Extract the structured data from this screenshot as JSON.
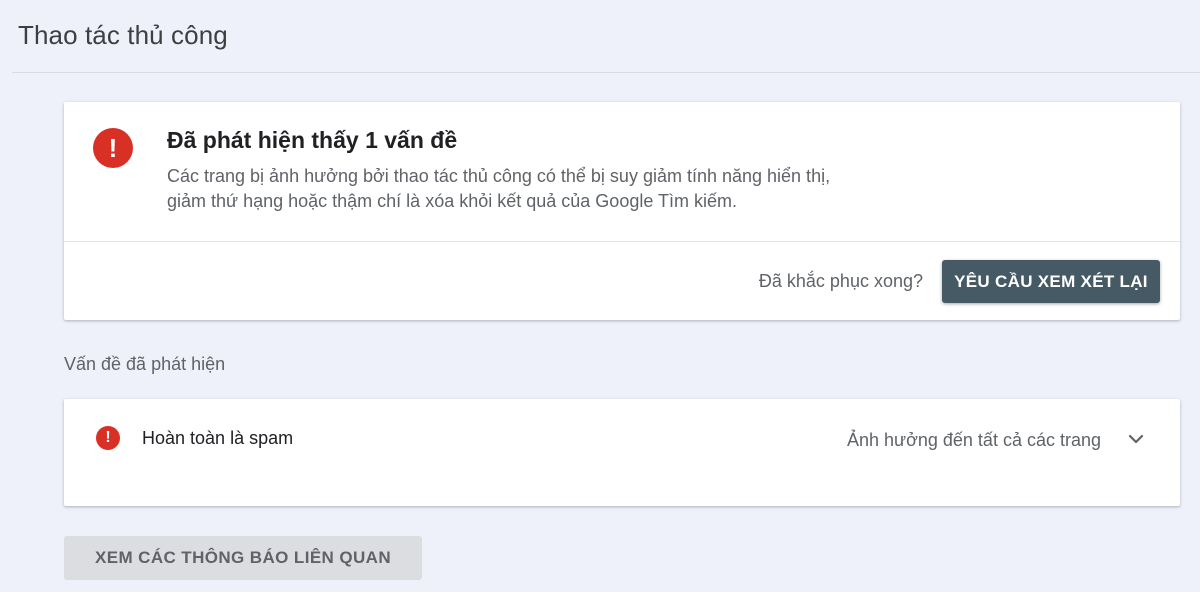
{
  "page": {
    "title": "Thao tác thủ công"
  },
  "summary": {
    "icon": "error-icon",
    "heading": "Đã phát hiện thấy 1 vấn đề",
    "description": "Các trang bị ảnh hưởng bởi thao tác thủ công có thể bị suy giảm tính năng hiển thị, giảm thứ hạng hoặc thậm chí là xóa khỏi kết quả của Google Tìm kiếm.",
    "fixed_question": "Đã khắc phục xong?",
    "request_review_label": "YÊU CẦU XEM XÉT LẠI"
  },
  "issues": {
    "section_label": "Vấn đề đã phát hiện",
    "items": [
      {
        "icon": "error-icon",
        "title": "Hoàn toàn là spam",
        "scope": "Ảnh hưởng đến tất cả các trang",
        "expand_icon": "chevron-down-icon"
      }
    ]
  },
  "footer": {
    "related_notices_label": "XEM CÁC THÔNG BÁO LIÊN QUAN"
  },
  "colors": {
    "background": "#eef1fa",
    "error": "#d93025",
    "primary_button": "#455a64",
    "secondary_button": "#dcdde0"
  }
}
